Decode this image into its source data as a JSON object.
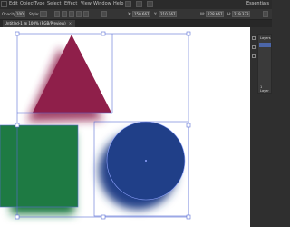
{
  "menubar": {
    "items": [
      "Edit",
      "Object",
      "Type",
      "Select",
      "Effect",
      "View",
      "Window",
      "Help"
    ],
    "workspace": "Essentials"
  },
  "controlbar": {
    "opacity_label": "Opacity:",
    "opacity_value": "100%",
    "style_label": "Style:",
    "x_label": "X:",
    "x_value": "150.667 pt",
    "y_label": "Y:",
    "y_value": "210.667 pt",
    "w_label": "W:",
    "w_value": "228.667 pt",
    "h_label": "H:",
    "h_value": "219.333 pt"
  },
  "document_tab": {
    "title": "Untitled-1 @ 100% (RGB/Preview)",
    "close": "×"
  },
  "layers_panel": {
    "title": "Layers",
    "footer": "1 Layer"
  },
  "shapes": {
    "triangle_color": "#8f1f4a",
    "square_color": "#1e7a43",
    "circle_color": "#203f88",
    "selection_color": "#5b6fd6"
  }
}
